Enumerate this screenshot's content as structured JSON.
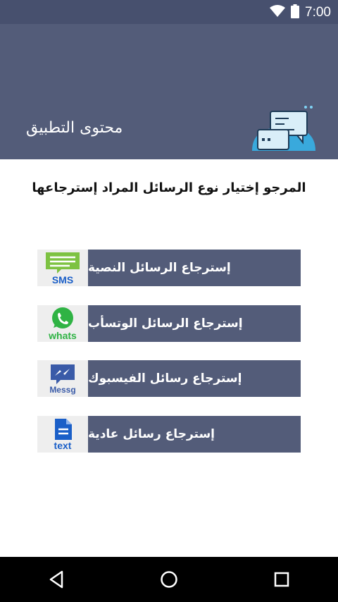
{
  "status_bar": {
    "time": "7:00",
    "icons": [
      "wifi-icon",
      "battery-icon"
    ]
  },
  "header": {
    "title": "محتوى التطبيق",
    "logo_icon": "chat-messages-icon"
  },
  "prompt": "المرجو إختيار نوع الرسائل المراد إسترجاعها",
  "options": [
    {
      "label": "إسترجاع الرسائل النصية",
      "icon_text": "SMS",
      "icon": "sms-icon"
    },
    {
      "label": "إسترجاع الرسائل الوتسأب",
      "icon_text": "whats",
      "icon": "whatsapp-icon"
    },
    {
      "label": "إسترجاع رسائل الفيسبوك",
      "icon_text": "Messg",
      "icon": "messenger-icon"
    },
    {
      "label": "إسترجاع رسائل عادية",
      "icon_text": "text",
      "icon": "text-document-icon"
    }
  ],
  "nav_bar": {
    "buttons": [
      "back-icon",
      "home-icon",
      "recents-icon"
    ]
  },
  "colors": {
    "primary": "#535c79",
    "status_bar": "#47506e",
    "sms_green": "#7dc242",
    "whatsapp_green": "#2fb344",
    "messenger_blue": "#3a5ba8",
    "text_blue": "#1a5fc8"
  }
}
